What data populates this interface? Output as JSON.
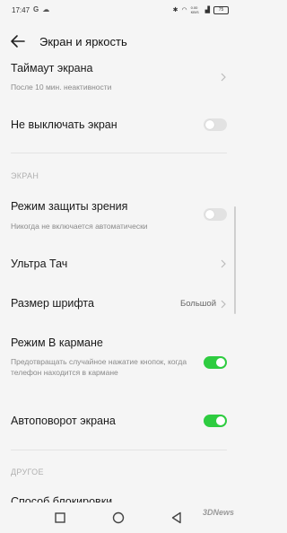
{
  "status_bar": {
    "time": "17:47",
    "net_speed": "0.00 KB/S",
    "battery": "75"
  },
  "header": {
    "title": "Экран и яркость"
  },
  "items": {
    "timeout": {
      "title": "Таймаут экрана",
      "subtitle": "После 10 мин. неактивности"
    },
    "keep_on": {
      "title": "Не выключать экран",
      "enabled": false
    },
    "section_screen": "ЭКРАН",
    "eye_protection": {
      "title": "Режим защиты зрения",
      "subtitle": "Никогда не включается автоматически",
      "enabled": false
    },
    "ultra_touch": {
      "title": "Ультра Тач"
    },
    "font_size": {
      "title": "Размер шрифта",
      "value": "Большой"
    },
    "pocket_mode": {
      "title": "Режим В кармане",
      "subtitle": "Предотвращать случайное нажатие кнопок, когда телефон находится в кармане",
      "enabled": true
    },
    "auto_rotate": {
      "title": "Автоповорот экрана",
      "enabled": true
    },
    "section_other": "ДРУГОЕ",
    "partial_item": "Способ блокировки"
  },
  "watermark": "3DNews",
  "colors": {
    "background": "#f5f5f5",
    "toggle_on": "#2ecc40",
    "toggle_off": "#e2e2e2"
  }
}
